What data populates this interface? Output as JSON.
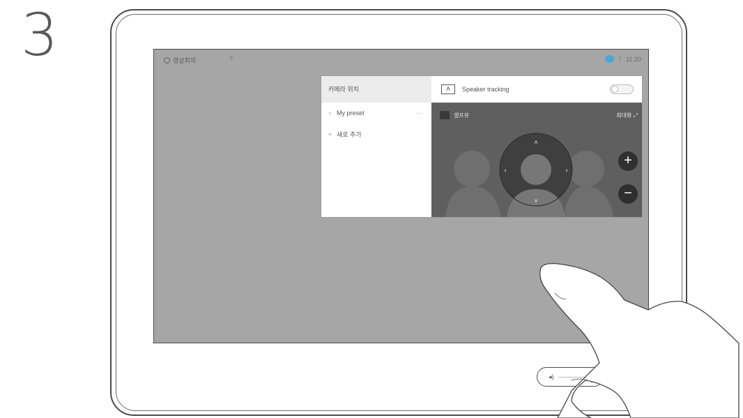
{
  "step": "3",
  "status_bar": {
    "left_label": "영상회의",
    "left_number": "?",
    "time": "11:20"
  },
  "preset_panel": {
    "header": "카메라 위치",
    "items": [
      {
        "label": "My preset",
        "more": "···"
      },
      {
        "label": "새로 추가"
      }
    ]
  },
  "camera_panel": {
    "tracking_icon_text": "A",
    "tracking_label": "Speaker tracking",
    "tracking_enabled": false,
    "selfview_label": "셀프뷰",
    "maximize_label": "최대화",
    "zoom_in_symbol": "+",
    "zoom_out_symbol": "−"
  },
  "colors": {
    "screen_bg": "#a6a6a6",
    "camera_bg": "#5f5f5f",
    "status_dot": "#4aa8d8"
  }
}
